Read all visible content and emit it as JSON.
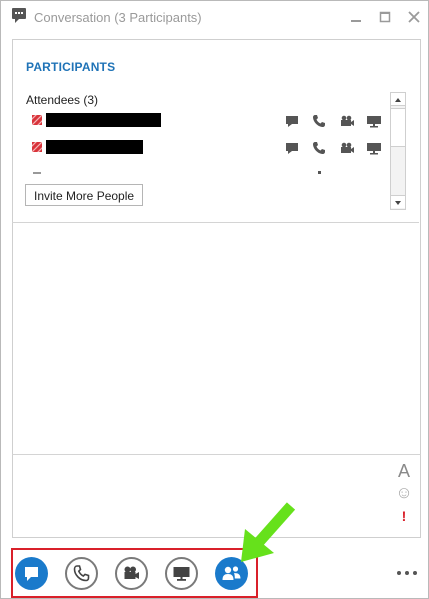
{
  "window": {
    "title": "Conversation (3 Participants)",
    "controls": [
      "minimize-icon",
      "maximize-icon",
      "close-icon"
    ]
  },
  "participants": {
    "heading": "PARTICIPANTS",
    "attendees_label": "Attendees (3)",
    "rows": [
      {
        "status": "presence-unknown-icon",
        "actions": [
          "im-icon",
          "phone-icon",
          "video-icon",
          "screen-icon"
        ]
      },
      {
        "status": "presence-unknown-icon",
        "actions": [
          "im-icon",
          "phone-icon",
          "video-icon",
          "screen-icon"
        ]
      }
    ],
    "invite_label": "Invite More People"
  },
  "compose": {
    "font_glyph": "A",
    "emoticon_glyph": "☺",
    "importance_glyph": "!"
  },
  "toolbar": {
    "buttons": [
      {
        "name": "im-button",
        "icon": "chat-bubble-icon",
        "active": true
      },
      {
        "name": "call-button",
        "icon": "phone-icon",
        "active": false
      },
      {
        "name": "video-button",
        "icon": "video-camera-icon",
        "active": false
      },
      {
        "name": "present-button",
        "icon": "monitor-icon",
        "active": false
      },
      {
        "name": "participants-button",
        "icon": "people-icon",
        "active": true
      }
    ],
    "more_glyph": "•••"
  },
  "colors": {
    "accent": "#1a7acb",
    "heading": "#1f73b7",
    "highlight_box": "#d9202a",
    "pointer_arrow": "#66e11b"
  }
}
